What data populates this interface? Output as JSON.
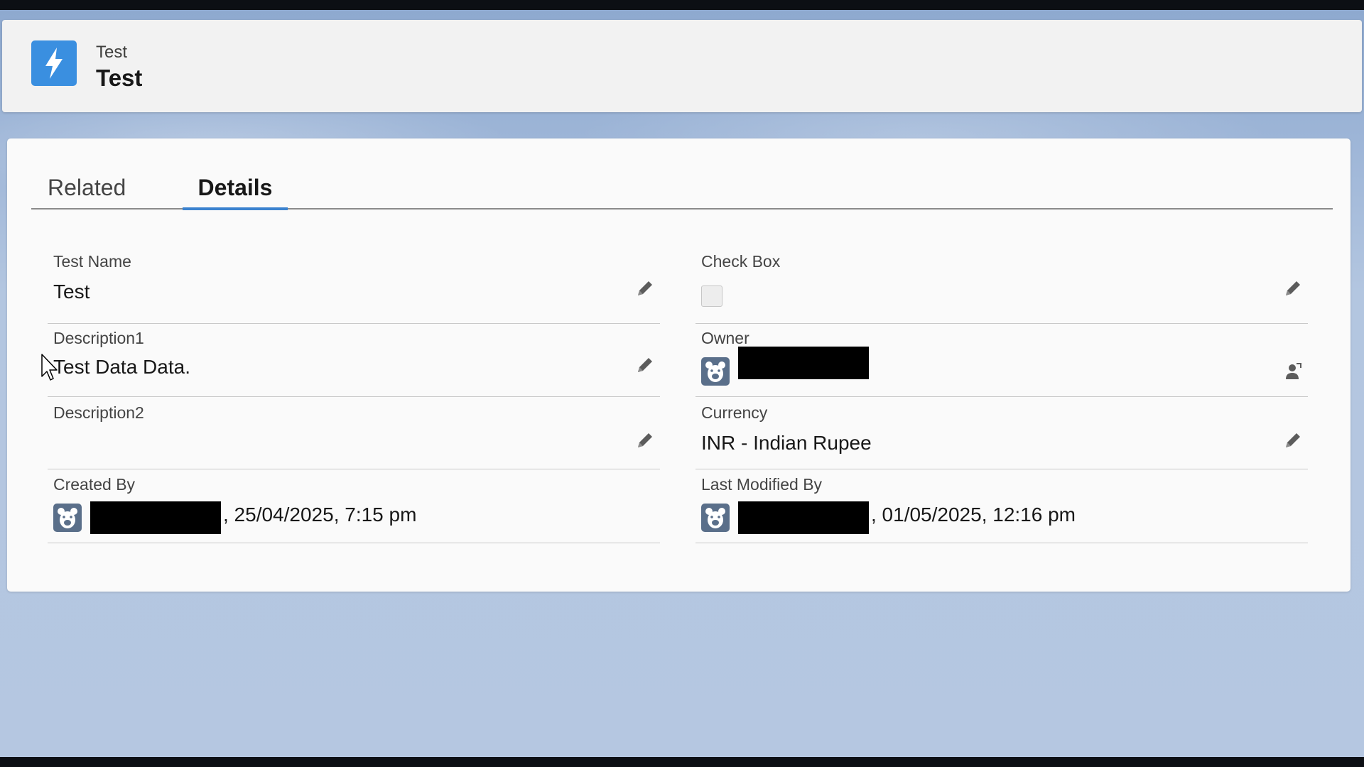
{
  "header": {
    "object_label": "Test",
    "record_title": "Test",
    "icon": "lightning-icon",
    "icon_color": "#3a8fe0"
  },
  "tabs": [
    {
      "label": "Related",
      "selected": false
    },
    {
      "label": "Details",
      "selected": true
    }
  ],
  "fields": {
    "test_name": {
      "label": "Test Name",
      "value": "Test"
    },
    "check_box": {
      "label": "Check Box",
      "checked": false
    },
    "description1": {
      "label": "Description1",
      "value": "Test Data Data."
    },
    "owner": {
      "label": "Owner",
      "value_redacted": true
    },
    "description2": {
      "label": "Description2",
      "value": ""
    },
    "currency": {
      "label": "Currency",
      "value": "INR - Indian Rupee"
    },
    "created_by": {
      "label": "Created By",
      "name_redacted": true,
      "timestamp": ", 25/04/2025, 7:15 pm"
    },
    "last_modified_by": {
      "label": "Last Modified By",
      "name_redacted": true,
      "timestamp": ", 01/05/2025, 12:16 pm"
    }
  },
  "icons": {
    "edit": "pencil-icon",
    "change_owner": "change-owner-icon",
    "user": "bear-avatar-icon"
  },
  "colors": {
    "accent": "#3b82cf",
    "avatar": "#5a6f8a"
  }
}
